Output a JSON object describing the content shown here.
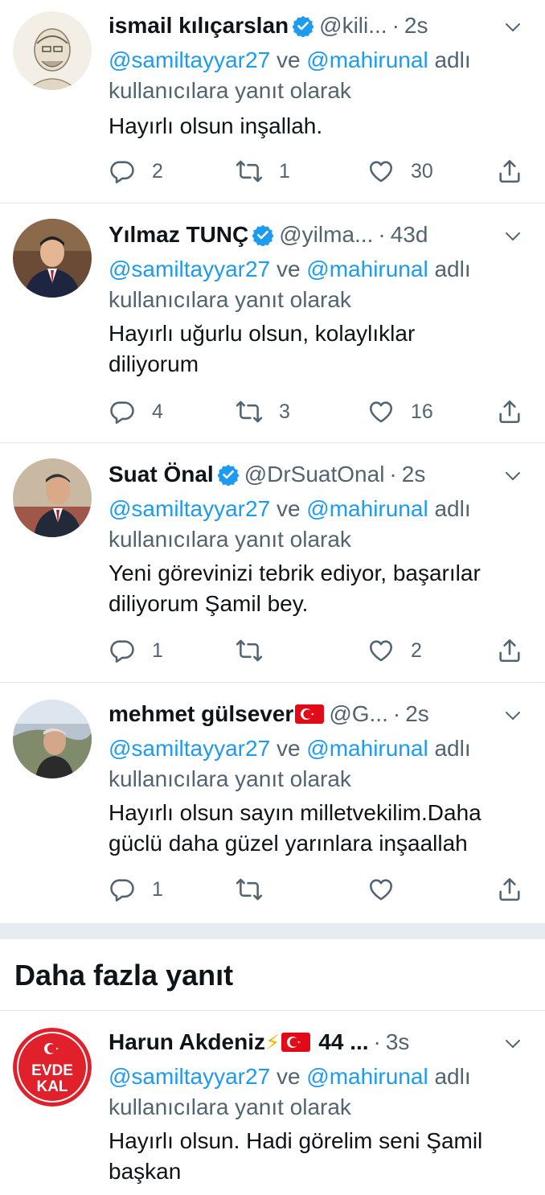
{
  "tweets": [
    {
      "name": "ismail kılıçarslan",
      "verified": true,
      "handle": "@kili...",
      "time": "2s",
      "reply_prefix": "",
      "mention1": "@samiltayyar27",
      "reply_mid": "ve",
      "mention2": "@mahirunal",
      "reply_suffix1": "adlı",
      "reply_suffix2": "kullanıcılara yanıt olarak",
      "text_lines": [
        "Hayırlı olsun inşallah."
      ],
      "replies": "2",
      "retweets": "1",
      "likes": "30"
    },
    {
      "name": "Yılmaz TUNÇ",
      "verified": true,
      "handle": "@yilma...",
      "time": "43d",
      "mention1": "@samiltayyar27",
      "reply_mid": "ve",
      "mention2": "@mahirunal",
      "reply_suffix1": "adlı",
      "reply_suffix2": "kullanıcılara yanıt olarak",
      "text_lines": [
        "Hayırlı uğurlu olsun, kolaylıklar",
        "diliyorum"
      ],
      "replies": "4",
      "retweets": "3",
      "likes": "16"
    },
    {
      "name": "Suat Önal",
      "verified": true,
      "handle": "@DrSuatOnal",
      "time": "2s",
      "mention1": "@samiltayyar27",
      "reply_mid": "ve",
      "mention2": "@mahirunal",
      "reply_suffix1": "adlı",
      "reply_suffix2": "kullanıcılara yanıt olarak",
      "text_lines": [
        "Yeni görevinizi tebrik ediyor, başarılar",
        "diliyorum Şamil bey."
      ],
      "replies": "1",
      "retweets": "",
      "likes": "2"
    },
    {
      "name": "mehmet gülsever",
      "verified": false,
      "handle": "@G...",
      "time": "2s",
      "mention1": "@samiltayyar27",
      "reply_mid": "ve",
      "mention2": "@mahirunal",
      "reply_suffix1": "adlı",
      "reply_suffix2": "kullanıcılara yanıt olarak",
      "text_lines": [
        "Hayırlı olsun sayın milletvekilim.Daha",
        "güclü daha güzel yarınlara inşaallah"
      ],
      "replies": "1",
      "retweets": "",
      "likes": ""
    }
  ],
  "more_replies_title": "Daha fazla yanıt",
  "last_tweet": {
    "name": "Harun Akdeniz",
    "handle": "44 ...",
    "time": "3s",
    "avatar_text_1": "EVDE",
    "avatar_text_2": "KAL",
    "mention1": "@samiltayyar27",
    "reply_mid": "ve",
    "mention2": "@mahirunal",
    "reply_suffix1": "adlı",
    "reply_suffix2": "kullanıcılara yanıt olarak",
    "text_lines": [
      "Hayırlı olsun. Hadi görelim seni Şamil",
      "başkan"
    ]
  },
  "colors": {
    "accent": "#1d9bf0",
    "muted": "#536471",
    "divider": "#e1e8ed",
    "evde_kal_red": "#e0202a"
  },
  "icons": [
    "reply-icon",
    "retweet-icon",
    "like-icon",
    "share-icon",
    "verified-badge-icon",
    "chevron-down-icon",
    "turkey-flag-icon",
    "lightning-icon"
  ]
}
